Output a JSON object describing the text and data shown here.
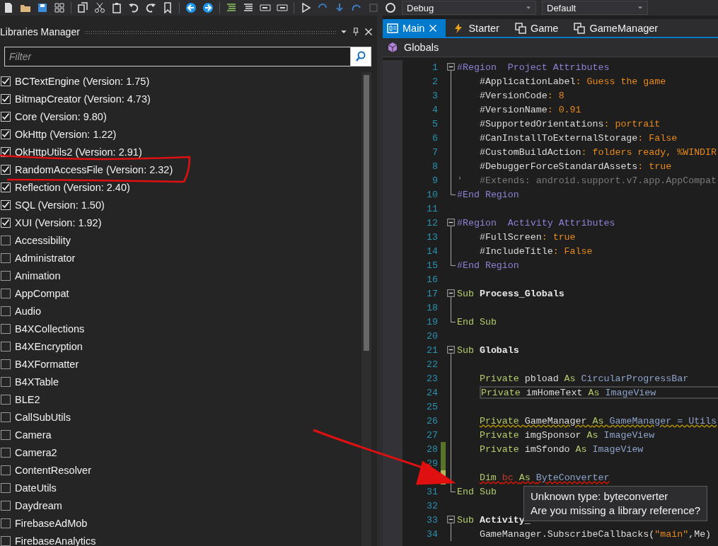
{
  "toolbar": {
    "configuration": "Debug",
    "target": "Default"
  },
  "libraries_manager": {
    "title": "Libraries Manager",
    "filter": {
      "placeholder": "Filter"
    },
    "libraries": [
      {
        "name": "BCTextEngine (Version: 1.75)",
        "checked": true
      },
      {
        "name": "BitmapCreator (Version: 4.73)",
        "checked": true
      },
      {
        "name": "Core (Version: 9.80)",
        "checked": true
      },
      {
        "name": "OkHttp (Version: 1.22)",
        "checked": true
      },
      {
        "name": "OkHttpUtils2 (Version: 2.91)",
        "checked": true
      },
      {
        "name": "RandomAccessFile (Version: 2.32)",
        "checked": true
      },
      {
        "name": "Reflection (Version: 2.40)",
        "checked": true
      },
      {
        "name": "SQL (Version: 1.50)",
        "checked": true
      },
      {
        "name": "XUI (Version: 1.92)",
        "checked": true
      },
      {
        "name": "Accessibility",
        "checked": false
      },
      {
        "name": "Administrator",
        "checked": false
      },
      {
        "name": "Animation",
        "checked": false
      },
      {
        "name": "AppCompat",
        "checked": false
      },
      {
        "name": "Audio",
        "checked": false
      },
      {
        "name": "B4XCollections",
        "checked": false
      },
      {
        "name": "B4XEncryption",
        "checked": false
      },
      {
        "name": "B4XFormatter",
        "checked": false
      },
      {
        "name": "B4XTable",
        "checked": false
      },
      {
        "name": "BLE2",
        "checked": false
      },
      {
        "name": "CallSubUtils",
        "checked": false
      },
      {
        "name": "Camera",
        "checked": false
      },
      {
        "name": "Camera2",
        "checked": false
      },
      {
        "name": "ContentResolver",
        "checked": false
      },
      {
        "name": "DateUtils",
        "checked": false
      },
      {
        "name": "Daydream",
        "checked": false
      },
      {
        "name": "FirebaseAdMob",
        "checked": false
      },
      {
        "name": "FirebaseAnalytics",
        "checked": false
      }
    ]
  },
  "tabs": [
    {
      "label": "Main",
      "selected": true,
      "kind": "main"
    },
    {
      "label": "Starter",
      "selected": false,
      "kind": "service"
    },
    {
      "label": "Game",
      "selected": false,
      "kind": "class"
    },
    {
      "label": "GameManager",
      "selected": false,
      "kind": "class"
    }
  ],
  "breadcrumb": "Globals",
  "code_lines": [
    {
      "num": "1",
      "collapse_box": true,
      "region_end": false,
      "indented": false,
      "tokens": [
        {
          "t": "#Region  Project Attributes",
          "kind": "dir"
        }
      ]
    },
    {
      "num": "2",
      "collapse_box": false,
      "region_end": false,
      "indented": true,
      "tokens": [
        {
          "t": "#ApplicationLabel",
          "kind": "attr"
        },
        {
          "t": ": Guess the game",
          "kind": "val"
        }
      ]
    },
    {
      "num": "3",
      "collapse_box": false,
      "region_end": false,
      "indented": true,
      "tokens": [
        {
          "t": "#VersionCode",
          "kind": "attr"
        },
        {
          "t": ": 8",
          "kind": "val"
        }
      ]
    },
    {
      "num": "4",
      "collapse_box": false,
      "region_end": false,
      "indented": true,
      "tokens": [
        {
          "t": "#VersionName",
          "kind": "attr"
        },
        {
          "t": ": 0.91",
          "kind": "val"
        }
      ]
    },
    {
      "num": "5",
      "collapse_box": false,
      "region_end": false,
      "indented": true,
      "tokens": [
        {
          "t": "#SupportedOrientations",
          "kind": "attr"
        },
        {
          "t": ": portrait",
          "kind": "val"
        }
      ]
    },
    {
      "num": "6",
      "collapse_box": false,
      "region_end": false,
      "indented": true,
      "tokens": [
        {
          "t": "#CanInstallToExternalStorage",
          "kind": "attr"
        },
        {
          "t": ": False",
          "kind": "val"
        }
      ]
    },
    {
      "num": "7",
      "collapse_box": false,
      "region_end": false,
      "indented": true,
      "tokens": [
        {
          "t": "#CustomBuildAction",
          "kind": "attr"
        },
        {
          "t": ": folders ready, %WINDIR",
          "kind": "val"
        }
      ]
    },
    {
      "num": "8",
      "collapse_box": false,
      "region_end": false,
      "indented": true,
      "tokens": [
        {
          "t": "#DebuggerForceStandardAssets",
          "kind": "attr"
        },
        {
          "t": ": true",
          "kind": "val"
        }
      ]
    },
    {
      "num": "9",
      "collapse_box": false,
      "region_end": false,
      "indented": false,
      "tokens": [
        {
          "t": "'   #Extends: android.support.v7.app.AppCompat",
          "kind": "comment"
        }
      ]
    },
    {
      "num": "10",
      "collapse_box": false,
      "region_end": true,
      "indented": false,
      "tokens": [
        {
          "t": "#End Region",
          "kind": "dir"
        }
      ]
    },
    {
      "num": "11",
      "collapse_box": false,
      "region_end": false
    },
    {
      "num": "12",
      "collapse_box": true,
      "region_end": false,
      "indented": false,
      "tokens": [
        {
          "t": "#Region  Activity Attributes",
          "kind": "dir"
        }
      ]
    },
    {
      "num": "13",
      "collapse_box": false,
      "region_end": false,
      "indented": true,
      "tokens": [
        {
          "t": "#FullScreen",
          "kind": "attr"
        },
        {
          "t": ": true",
          "kind": "val"
        }
      ]
    },
    {
      "num": "14",
      "collapse_box": false,
      "region_end": false,
      "indented": true,
      "tokens": [
        {
          "t": "#IncludeTitle",
          "kind": "attr"
        },
        {
          "t": ": False",
          "kind": "val"
        }
      ]
    },
    {
      "num": "15",
      "collapse_box": false,
      "region_end": true,
      "indented": false,
      "tokens": [
        {
          "t": "#End Region",
          "kind": "dir"
        }
      ]
    },
    {
      "num": "16",
      "collapse_box": false,
      "region_end": false
    },
    {
      "num": "17",
      "collapse_box": true,
      "region_end": false,
      "indented": false,
      "tokens": [
        {
          "t": "Sub ",
          "kind": "kw"
        },
        {
          "t": "Process_Globals",
          "kind": "bold"
        }
      ]
    },
    {
      "num": "18",
      "collapse_box": false,
      "region_end": false
    },
    {
      "num": "19",
      "collapse_box": false,
      "region_end": true,
      "indented": false,
      "tokens": [
        {
          "t": "End Sub",
          "kind": "kw"
        }
      ]
    },
    {
      "num": "20",
      "collapse_box": false,
      "region_end": false
    },
    {
      "num": "21",
      "collapse_box": true,
      "region_end": false,
      "indented": false,
      "tokens": [
        {
          "t": "Sub ",
          "kind": "kw"
        },
        {
          "t": "Globals",
          "kind": "bold"
        }
      ]
    },
    {
      "num": "22",
      "collapse_box": false,
      "region_end": false
    },
    {
      "num": "23",
      "collapse_box": false,
      "region_end": false,
      "indented": true,
      "tokens": [
        {
          "t": "Private ",
          "kind": "kw"
        },
        {
          "t": "pbload ",
          "kind": "name"
        },
        {
          "t": "As ",
          "kind": "kw"
        },
        {
          "t": "CircularProgressBar",
          "kind": "type"
        }
      ]
    },
    {
      "num": "24",
      "collapse_box": false,
      "region_end": false,
      "indented": true,
      "current": true,
      "tokens": [
        {
          "t": "Private ",
          "kind": "kw"
        },
        {
          "t": "imHomeText ",
          "kind": "name"
        },
        {
          "t": "As ",
          "kind": "kw"
        },
        {
          "t": "ImageView",
          "kind": "type"
        }
      ]
    },
    {
      "num": "25",
      "collapse_box": false,
      "region_end": false
    },
    {
      "num": "26",
      "collapse_box": false,
      "region_end": false,
      "indented": true,
      "warning": true,
      "tokens": [
        {
          "t": "Private ",
          "kind": "kw"
        },
        {
          "t": "GameManager ",
          "kind": "name"
        },
        {
          "t": "As ",
          "kind": "kw"
        },
        {
          "t": "GameManager = Utils",
          "kind": "type"
        }
      ]
    },
    {
      "num": "27",
      "collapse_box": false,
      "region_end": false,
      "indented": true,
      "tokens": [
        {
          "t": "Private ",
          "kind": "kw"
        },
        {
          "t": "imgSponsor ",
          "kind": "name"
        },
        {
          "t": "As ",
          "kind": "kw"
        },
        {
          "t": "ImageView",
          "kind": "type"
        }
      ]
    },
    {
      "num": "28",
      "collapse_box": false,
      "region_end": false,
      "indented": true,
      "modified": true,
      "saved": true,
      "tokens": [
        {
          "t": "Private ",
          "kind": "kw"
        },
        {
          "t": "imSfondo ",
          "kind": "name"
        },
        {
          "t": "As ",
          "kind": "kw"
        },
        {
          "t": "ImageView",
          "kind": "type"
        }
      ]
    },
    {
      "num": "29",
      "collapse_box": false,
      "region_end": false,
      "modified": true,
      "saved": true
    },
    {
      "collapse_box": false,
      "region_end": false,
      "indented": true,
      "modified": true,
      "saved": false,
      "error": true,
      "tokens": [
        {
          "t": "Dim ",
          "kind": "kw"
        },
        {
          "t": "bc ",
          "kind": "err"
        },
        {
          "t": "As ",
          "kind": "kw"
        },
        {
          "t": "ByteConverter",
          "kind": "type"
        }
      ]
    },
    {
      "num": "31",
      "collapse_box": false,
      "region_end": true,
      "indented": false,
      "tokens": [
        {
          "t": "End Sub",
          "kind": "kw"
        }
      ]
    },
    {
      "num": "32",
      "collapse_box": false,
      "region_end": false
    },
    {
      "num": "33",
      "collapse_box": true,
      "region_end": false,
      "indented": false,
      "tokens": [
        {
          "t": "Sub ",
          "kind": "kw"
        },
        {
          "t": "Activity_",
          "kind": "bold"
        }
      ]
    },
    {
      "num": "34",
      "collapse_box": false,
      "region_end": false,
      "indented": true,
      "tokens": [
        {
          "t": "GameManager.SubscribeCallbacks(",
          "kind": "name"
        },
        {
          "t": "\"main\"",
          "kind": "val"
        },
        {
          "t": ",Me)",
          "kind": "name"
        }
      ]
    }
  ],
  "tooltip": [
    "Unknown type: byteconverter",
    "Are you missing a library reference?"
  ]
}
